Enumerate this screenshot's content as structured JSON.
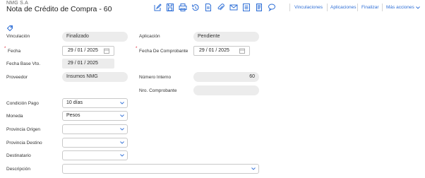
{
  "header": {
    "company": "NMG S.A",
    "title": "Nota de Crédito de Compra - 60"
  },
  "toolbar": {
    "icons": [
      "edit-icon",
      "save-icon",
      "print-icon",
      "history-icon",
      "document-icon",
      "attach-icon",
      "mail-icon",
      "checklist-icon",
      "notes-icon",
      "comment-icon"
    ],
    "links": {
      "vinculaciones": "Vinculaciones",
      "aplicaciones": "Aplicaciones",
      "finalizar": "Finalizar",
      "mas_acciones": "Más acciones"
    },
    "accent_color": "#2f6fd6"
  },
  "form": {
    "vinculacion": {
      "label": "Vinculación",
      "value": "Finalizado"
    },
    "aplicacion": {
      "label": "Aplicación",
      "value": "Pendiente"
    },
    "fecha": {
      "label": "Fecha",
      "required_mark": "*",
      "day": "29",
      "month": "01",
      "year": "2025"
    },
    "fecha_comprobante": {
      "label": "Fecha De Comprobante",
      "required_mark": "*",
      "day": "29",
      "month": "01",
      "year": "2025"
    },
    "fecha_base_vto": {
      "label": "Fecha Base Vto.",
      "day": "29",
      "month": "01",
      "year": "2025"
    },
    "proveedor": {
      "label": "Proveedor",
      "value": "Insumos NMG"
    },
    "numero_interno": {
      "label": "Número Interno",
      "value": "60"
    },
    "nro_comprobante": {
      "label": "Nro. Comprobante",
      "value": ""
    },
    "condicion_pago": {
      "label": "Condición Pago",
      "value": "10 días"
    },
    "moneda": {
      "label": "Moneda",
      "value": "Pesos"
    },
    "provincia_origen": {
      "label": "Provincia Origen",
      "value": ""
    },
    "provincia_destino": {
      "label": "Provincia Destino",
      "value": ""
    },
    "destinatario": {
      "label": "Destinatario",
      "value": ""
    },
    "descripcion": {
      "label": "Descripción",
      "value": ""
    }
  }
}
